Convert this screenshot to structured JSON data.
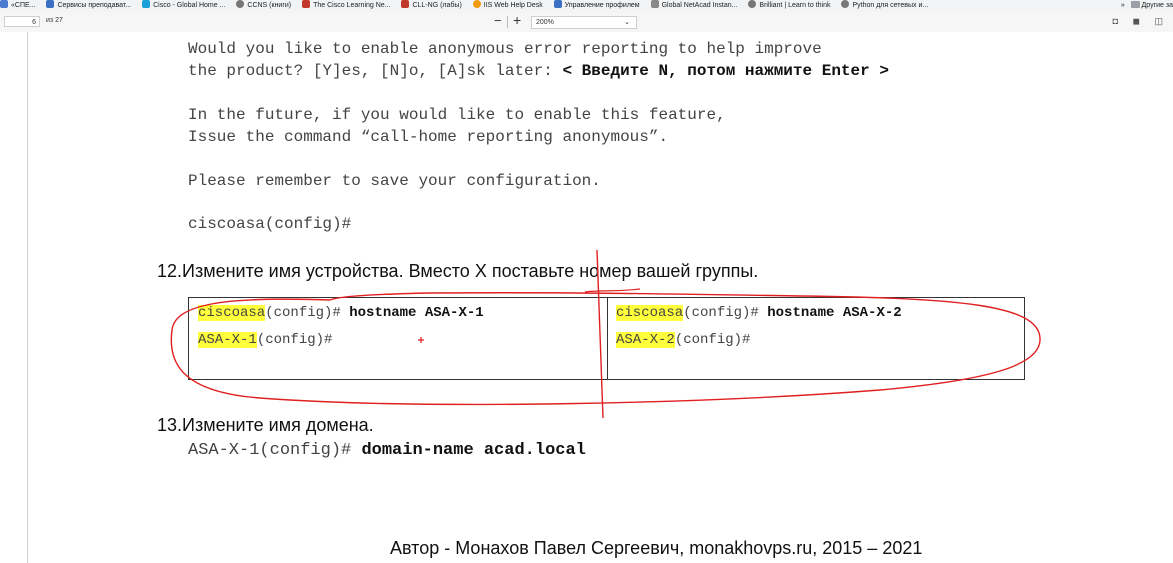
{
  "bookmarks": [
    {
      "label": "«СПЕ...",
      "icon": "page-icon",
      "color": "#4a7bd0"
    },
    {
      "label": "Сервисы преподават...",
      "icon": "page-icon",
      "color": "#3a6fc4"
    },
    {
      "label": "Cisco - Global Home ...",
      "icon": "cisco-icon",
      "color": "#1ba0d7"
    },
    {
      "label": "CCNS (книги)",
      "icon": "globe-icon",
      "color": "#777777"
    },
    {
      "label": "The Cisco Learning Ne...",
      "icon": "cisco-icon",
      "color": "#c0392b"
    },
    {
      "label": "CLL-NG (лабы)",
      "icon": "cisco-icon",
      "color": "#c0392b"
    },
    {
      "label": "IIS Web Help Desk",
      "icon": "help-icon",
      "color": "#f39c12"
    },
    {
      "label": "Управление профилем",
      "icon": "page-icon",
      "color": "#3a6fc4"
    },
    {
      "label": "Global NetAcad Instan...",
      "icon": "cisco-icon",
      "color": "#888888"
    },
    {
      "label": "Brilliant | Learn to think",
      "icon": "globe-icon",
      "color": "#777777"
    },
    {
      "label": "Python для сетевых и...",
      "icon": "globe-icon",
      "color": "#777777"
    }
  ],
  "bookmarks_more": "»",
  "bookmarks_other": "Другие за",
  "toolbar": {
    "page_current": "6",
    "page_total": "из 27",
    "zoom_out": "−",
    "zoom_in": "+",
    "zoom_value": "200%",
    "chevron": "⌄",
    "right_icons": "◘ ◼ ◫"
  },
  "doc": {
    "code_lines": [
      "Would you like to enable anonymous error reporting to help improve",
      "the product? [Y]es, [N]o, [A]sk later: ",
      "",
      "In the future, if you would like to enable this feature,",
      "Issue the command “call-home reporting anonymous”.",
      "",
      "Please remember to save your configuration.",
      "",
      "ciscoasa(config)#"
    ],
    "code_bold": "< Введите N, потом нажмите Enter >",
    "step12": {
      "number": "12.",
      "text": "Измените имя устройства. Вместо X поставьте номер вашей группы."
    },
    "table": {
      "left": {
        "l1_host": "ciscoasa",
        "l1_prompt": "(config)# ",
        "l1_cmd": "hostname ASA-X-1",
        "l2_host": "ASA-X-1",
        "l2_prompt": "(config)#"
      },
      "right": {
        "l1_host": "ciscoasa",
        "l1_prompt": "(config)# ",
        "l1_cmd": "hostname ASA-X-2",
        "l2_host": "ASA-X-2",
        "l2_prompt": "(config)#"
      }
    },
    "step13": {
      "number": "13.",
      "text": "Измените имя домена.",
      "prompt": "ASA-X-1(config)# ",
      "cmd": "domain-name acad.local"
    },
    "footer": "Автор - Монахов Павел Сергеевич, monakhovps.ru, 2015 – 2021"
  },
  "colors": {
    "highlight": "#ffff3c",
    "annotation": "#e02020"
  }
}
